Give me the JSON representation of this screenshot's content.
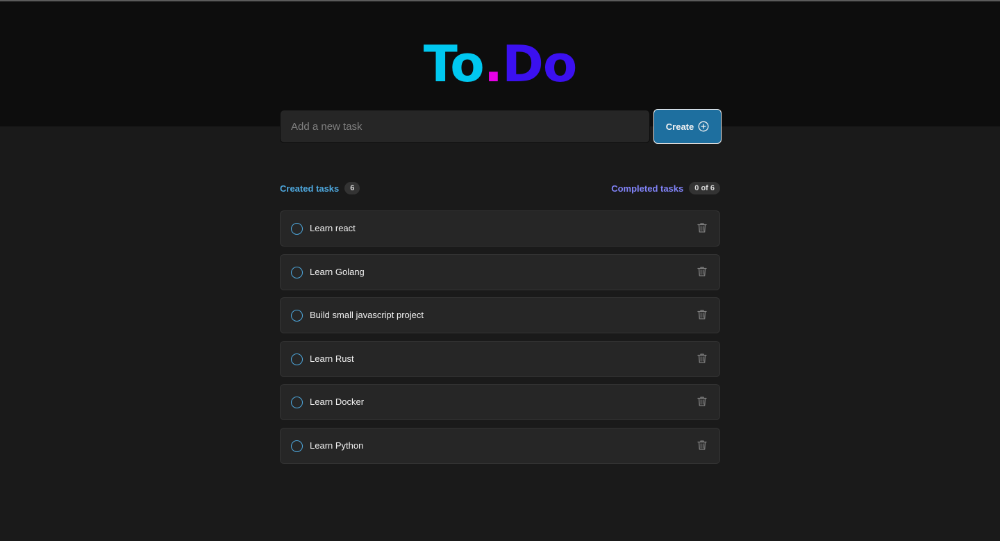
{
  "logo": {
    "part1": "To",
    "part2": ".",
    "part3": "Do"
  },
  "new_task": {
    "placeholder": "Add a new task",
    "value": ""
  },
  "create_button": {
    "label": "Create"
  },
  "counters": {
    "created_label": "Created tasks",
    "created_count": "6",
    "completed_label": "Completed tasks",
    "completed_count": "0 of 6"
  },
  "tasks": [
    {
      "text": "Learn react",
      "done": false
    },
    {
      "text": "Learn Golang",
      "done": false
    },
    {
      "text": "Build small javascript project",
      "done": false
    },
    {
      "text": "Learn Rust",
      "done": false
    },
    {
      "text": "Learn Docker",
      "done": false
    },
    {
      "text": "Learn Python",
      "done": false
    }
  ],
  "colors": {
    "logo_to": "#00c8f0",
    "logo_dot": "#e600e6",
    "logo_do": "#3b10f0",
    "accent_blue": "#4ea8de",
    "accent_purple": "#8284fa",
    "button": "#1e6f9f"
  },
  "icons": {
    "create": "plus-circle-icon",
    "check": "circle-outline-icon",
    "delete": "trash-icon"
  }
}
